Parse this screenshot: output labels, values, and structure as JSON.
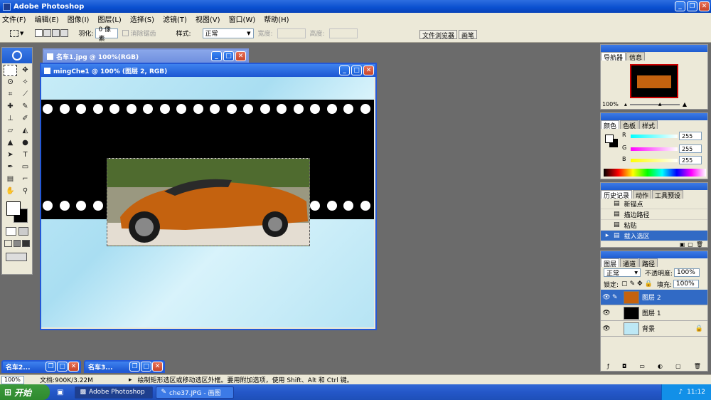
{
  "app": {
    "title": "Adobe Photoshop"
  },
  "menu": [
    "文件(F)",
    "编辑(E)",
    "图像(I)",
    "图层(L)",
    "选择(S)",
    "滤镜(T)",
    "视图(V)",
    "窗口(W)",
    "帮助(H)"
  ],
  "options": {
    "feather_label": "羽化:",
    "feather_value": "0 像素",
    "antialias_label": "消除锯齿",
    "style_label": "样式:",
    "style_value": "正常",
    "width_label": "宽度:",
    "height_label": "高度:"
  },
  "palette_well": [
    "文件浏览器",
    "画笔"
  ],
  "documents": {
    "back_title": "名车1.jpg @ 100%(RGB)",
    "front_title": "mingChe1 @ 100% (图层 2, RGB)"
  },
  "navigator": {
    "tabs": [
      "导航器",
      "信息"
    ],
    "zoom": "100%"
  },
  "color": {
    "tabs": [
      "颜色",
      "色板",
      "样式"
    ],
    "r_label": "R",
    "g_label": "G",
    "b_label": "B",
    "r": "255",
    "g": "255",
    "b": "255"
  },
  "history": {
    "tabs": [
      "历史记录",
      "动作",
      "工具预设"
    ],
    "items": [
      "新锚点",
      "描边路径",
      "粘贴",
      "载入选区"
    ]
  },
  "layers": {
    "tabs": [
      "图层",
      "通道",
      "路径"
    ],
    "blend": "正常",
    "opacity_label": "不透明度:",
    "opacity": "100%",
    "lock_label": "锁定:",
    "fill_label": "填充:",
    "fill": "100%",
    "items": [
      "图层 2",
      "图层 1",
      "背景"
    ]
  },
  "minimized": [
    "名车2...",
    "名车3..."
  ],
  "status": {
    "zoom": "100%",
    "doc": "文档:900K/3.22M",
    "hint": "绘制矩形选区或移动选区外框。要用附加选项，使用 Shift、Alt 和 Ctrl 键。"
  },
  "taskbar": {
    "start": "开始",
    "tasks": [
      "Adobe Photoshop",
      "che37.JPG - 画图"
    ],
    "clock": "11:12"
  },
  "colors": {
    "xp_blue": "#0a4fcf",
    "selection": "#316ac5",
    "panel": "#ece9d8"
  }
}
